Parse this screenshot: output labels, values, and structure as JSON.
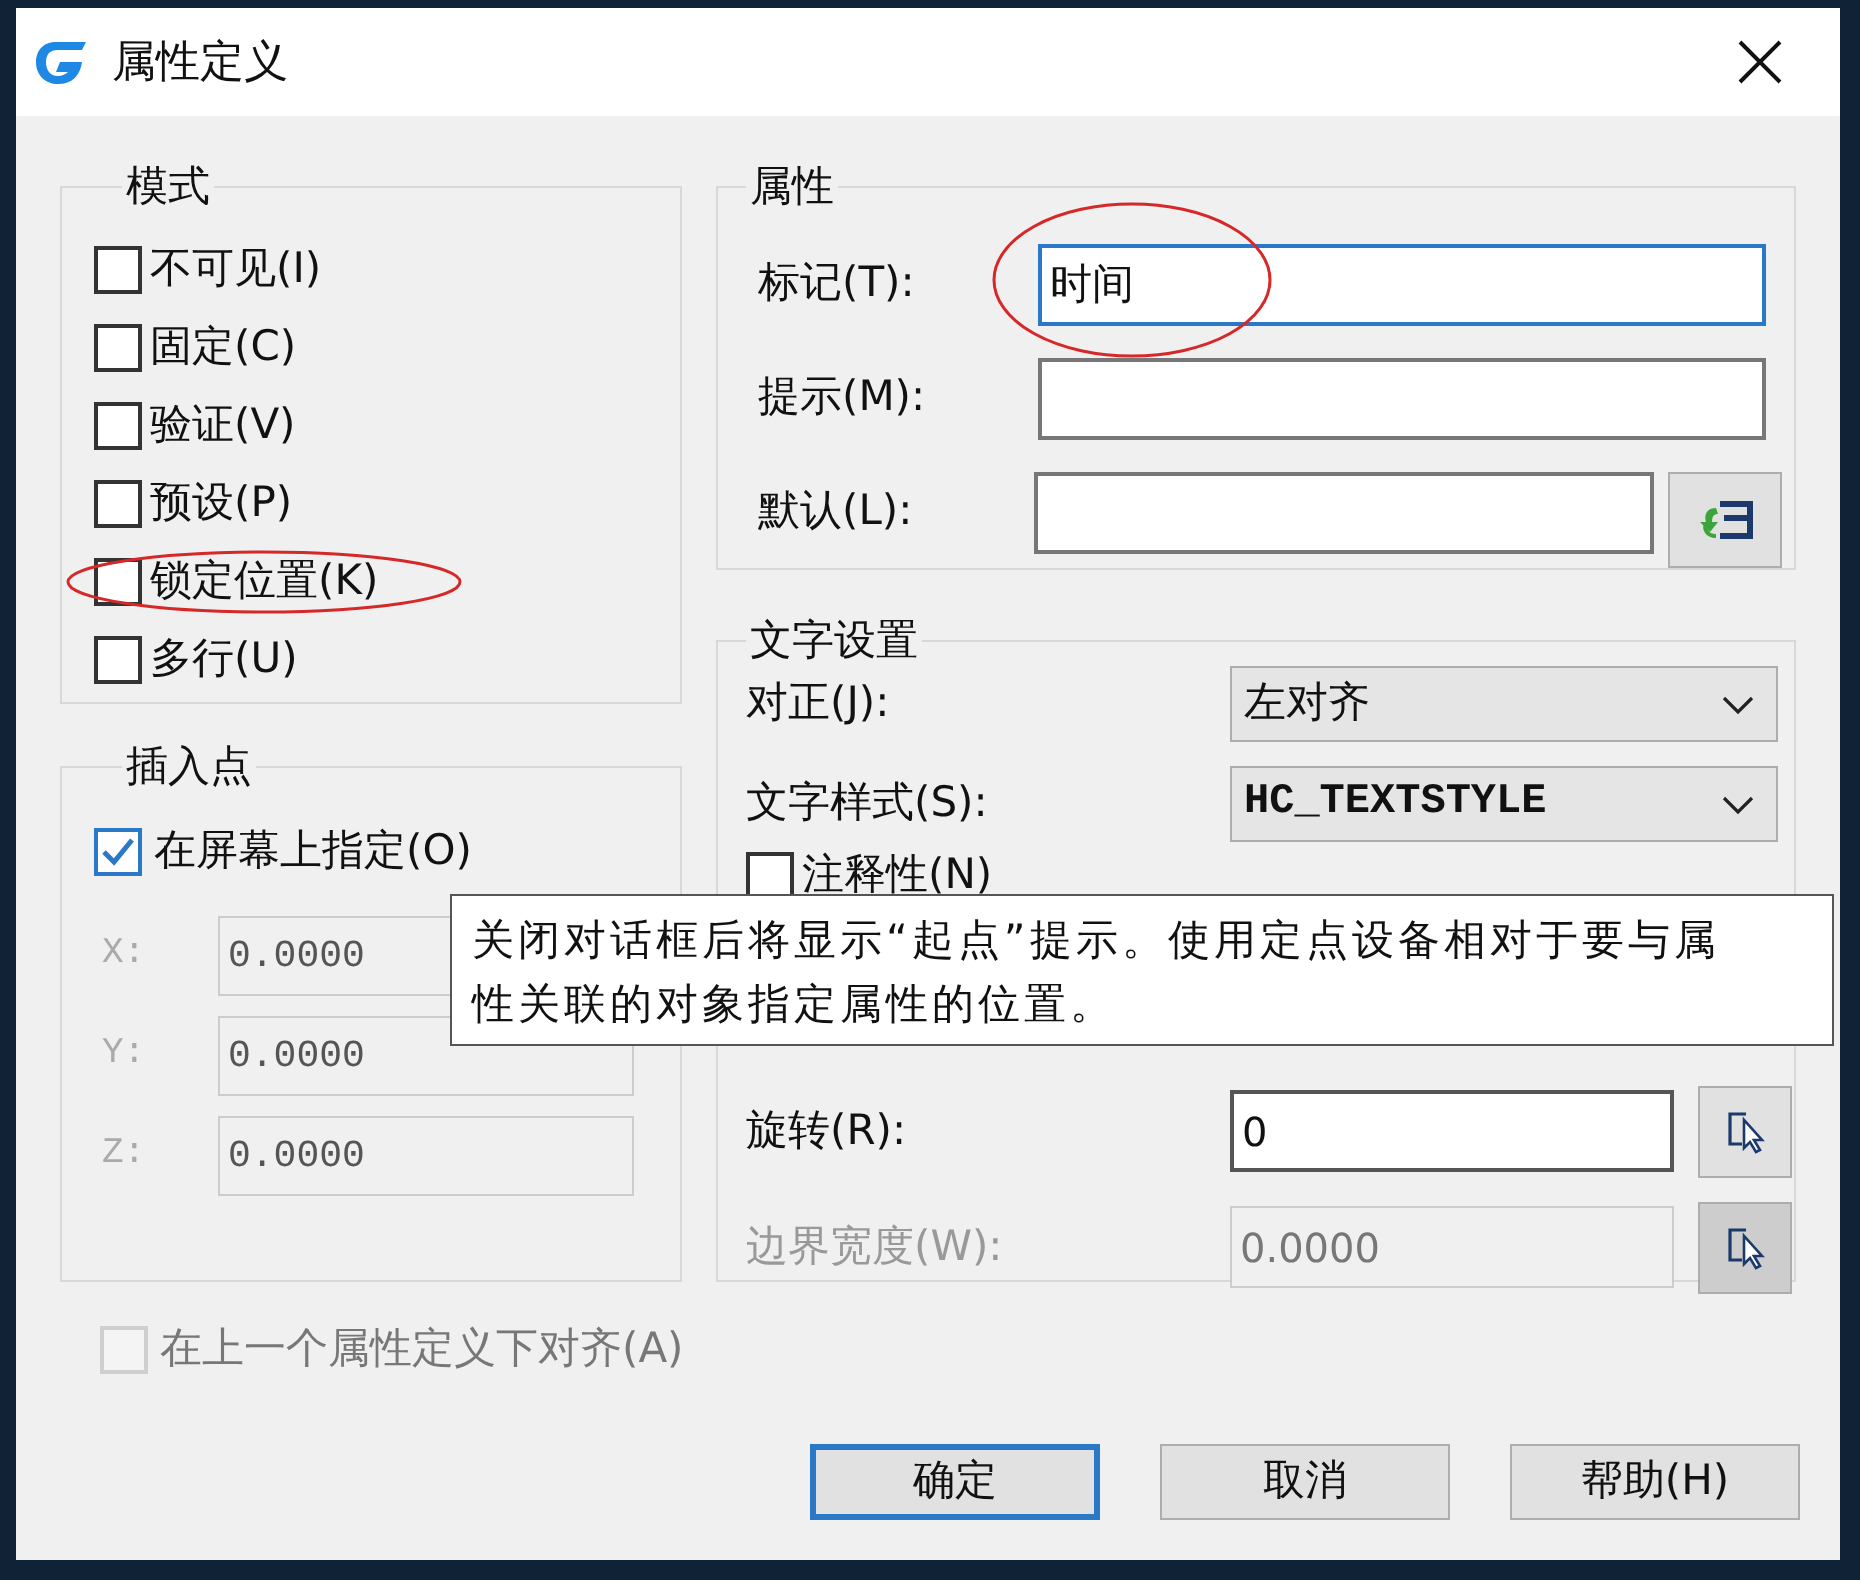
{
  "window": {
    "title": "属性定义"
  },
  "mode": {
    "title": "模式",
    "options": [
      {
        "label": "不可见(I)",
        "checked": false,
        "circled": false
      },
      {
        "label": "固定(C)",
        "checked": false,
        "circled": false
      },
      {
        "label": "验证(V)",
        "checked": false,
        "circled": false
      },
      {
        "label": "预设(P)",
        "checked": false,
        "circled": false
      },
      {
        "label": "锁定位置(K)",
        "checked": false,
        "circled": true
      },
      {
        "label": "多行(U)",
        "checked": false,
        "circled": false
      }
    ]
  },
  "insertion_point": {
    "title": "插入点",
    "specify_on_screen": {
      "label": "在屏幕上指定(O)",
      "checked": true
    },
    "coordinates": [
      {
        "label": "X:",
        "value": "0.0000",
        "disabled": true
      },
      {
        "label": "Y:",
        "value": "0.0000",
        "disabled": true
      },
      {
        "label": "Z:",
        "value": "0.0000",
        "disabled": true
      }
    ]
  },
  "align_below": {
    "label": "在上一个属性定义下对齐(A)",
    "checked": false,
    "disabled": true
  },
  "attribute": {
    "title": "属性",
    "fields": [
      {
        "kind": "text",
        "label": "标记(T):",
        "value": "时间",
        "focused": true,
        "circled": true
      },
      {
        "kind": "text",
        "label": "提示(M):",
        "focused": false,
        "circled": false
      },
      {
        "kind": "with_button",
        "label": "默认(L):",
        "focused": false,
        "circled": false
      }
    ]
  },
  "text_settings": {
    "title": "文字设置",
    "justification": {
      "label": "对正(J):",
      "value": "左对齐"
    },
    "text_style": {
      "label": "文字样式(S):",
      "value": "HC_TEXTSTYLE"
    },
    "annotative": {
      "label": "注释性(N)",
      "checked": false
    },
    "rotation": {
      "label": "旋转(R):",
      "value": "0",
      "disabled": false
    },
    "boundary_width": {
      "label": "边界宽度(W):",
      "value": "0.0000",
      "disabled": true
    }
  },
  "tooltip": {
    "text": "关闭对话框后将显示“起点”提示。使用定点设备相对于要与属性关联的对象指定属性的位置。"
  },
  "buttons": [
    {
      "label": "确定",
      "default": true
    },
    {
      "label": "取消",
      "default": false
    },
    {
      "label": "帮助(H)",
      "default": false
    }
  ]
}
